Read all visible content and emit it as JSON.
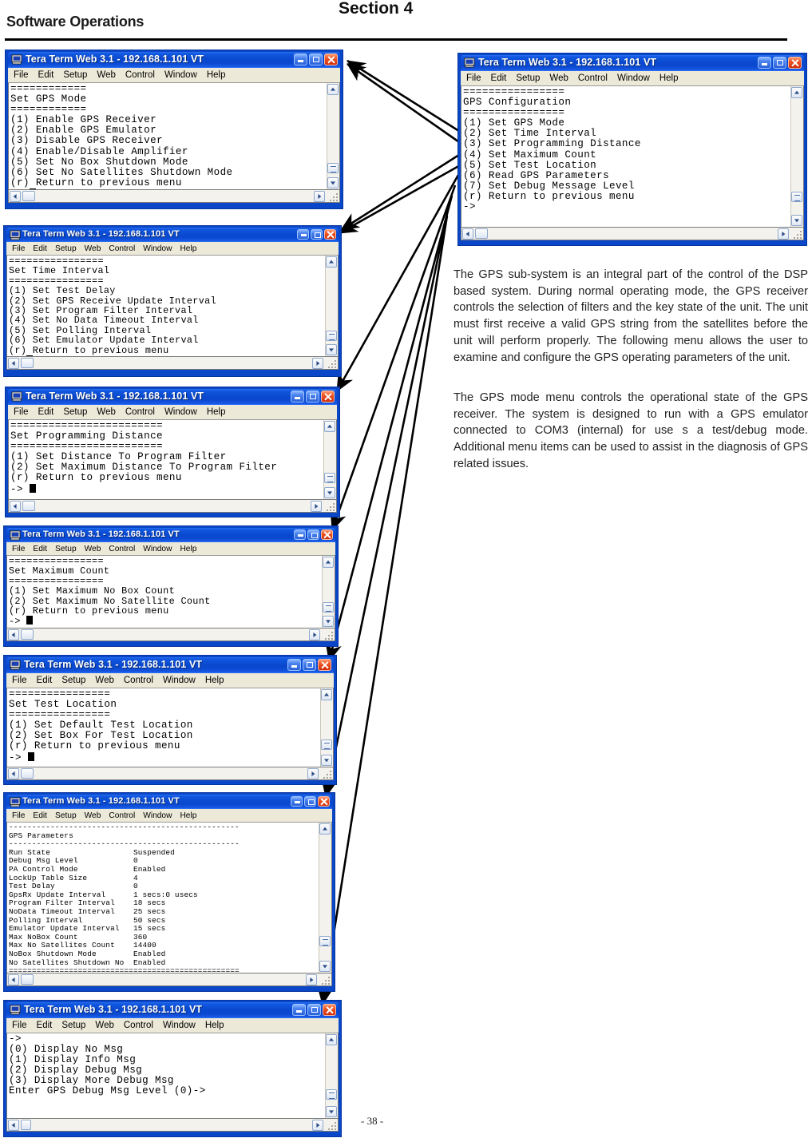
{
  "page": {
    "doc_title": "Software Operations",
    "section_label": "Section 4",
    "page_number": "- 38 -"
  },
  "body_text": {
    "paragraph_1": "The GPS sub-system is an integral part of the control of the DSP based system. During normal operating mode, the GPS receiver controls the selection of filters and the key state of the unit. The unit must first receive a valid GPS string from the satellites before the unit will perform properly. The following menu allows the user to examine and configure the GPS operating parameters of the unit.",
    "paragraph_2": "The GPS mode menu controls the operational state of the GPS receiver. The system is designed to run with a GPS emulator connected to COM3 (internal) for use s a test/debug mode. Additional menu items can be used to assist in the diagnosis of GPS related issues."
  },
  "window_common": {
    "title": "Tera Term Web 3.1 - 192.168.1.101 VT",
    "menus": [
      "File",
      "Edit",
      "Setup",
      "Web",
      "Control",
      "Window",
      "Help"
    ],
    "buttons": {
      "minimize": "Minimize",
      "maximize": "Maximize",
      "close": "Close"
    },
    "icons": {
      "app": "terminal-computer-icon",
      "minimize": "minimize-icon",
      "maximize": "maximize-icon",
      "close": "close-icon",
      "scroll_up": "scroll-up-arrow-icon",
      "scroll_down": "scroll-down-arrow-icon",
      "scroll_left": "scroll-left-arrow-icon",
      "scroll_right": "scroll-right-arrow-icon",
      "resize_grip": "resize-grip-icon"
    }
  },
  "windows": {
    "gps_mode": {
      "name": "Set GPS Mode",
      "terminal": "============\nSet GPS Mode\n============\n(1) Enable GPS Receiver\n(2) Enable GPS Emulator\n(3) Disable GPS Receiver\n(4) Enable/Disable Amplifier\n(5) Set No Box Shutdown Mode\n(6) Set No Satellites Shutdown Mode\n(r) Return to previous menu\n-> "
    },
    "time_interval": {
      "name": "Set Time Interval",
      "terminal": "================\nSet Time Interval\n================\n(1) Set Test Delay\n(2) Set GPS Receive Update Interval\n(3) Set Program Filter Interval\n(4) Set No Data Timeout Interval\n(5) Set Polling Interval\n(6) Set Emulator Update Interval\n(r) Return to previous menu\n-> "
    },
    "programming_distance": {
      "name": "Set Programming Distance",
      "terminal": "========================\nSet Programming Distance\n========================\n(1) Set Distance To Program Filter\n(2) Set Maximum Distance To Program Filter\n(r) Return to previous menu\n-> "
    },
    "maximum_count": {
      "name": "Set Maximum Count",
      "terminal": "================\nSet Maximum Count\n================\n(1) Set Maximum No Box Count\n(2) Set Maximum No Satellite Count\n(r) Return to previous menu\n-> "
    },
    "test_location": {
      "name": "Set Test Location",
      "terminal": "================\nSet Test Location\n================\n(1) Set Default Test Location\n(2) Set Box For Test Location\n(r) Return to previous menu\n-> "
    },
    "gps_parameters": {
      "name": "GPS Parameters",
      "terminal": "--------------------------------------------------\nGPS Parameters\n--------------------------------------------------\nRun State                  Suspended\nDebug Msg Level            0\nPA Control Mode            Enabled\nLockUp Table Size          4\nTest Delay                 0\nGpsRx Update Interval      1 secs:0 usecs\nProgram Filter Interval    18 secs\nNoData Timeout Interval    25 secs\nPolling Interval           50 secs\nEmulator Update Interval   15 secs\nMax NoBox Count            360\nMax No Satellites Count    14400\nNoBox Shutdown Mode        Enabled\nNo Satellites Shutdown No  Enabled\n==================================================",
      "rows": [
        {
          "label": "Run State",
          "value": "Suspended"
        },
        {
          "label": "Debug Msg Level",
          "value": "0"
        },
        {
          "label": "PA Control Mode",
          "value": "Enabled"
        },
        {
          "label": "LockUp Table Size",
          "value": "4"
        },
        {
          "label": "Test Delay",
          "value": "0"
        },
        {
          "label": "GpsRx Update Interval",
          "value": "1 secs:0 usecs"
        },
        {
          "label": "Program Filter Interval",
          "value": "18 secs"
        },
        {
          "label": "NoData Timeout Interval",
          "value": "25 secs"
        },
        {
          "label": "Polling Interval",
          "value": "50 secs"
        },
        {
          "label": "Emulator Update Interval",
          "value": "15 secs"
        },
        {
          "label": "Max NoBox Count",
          "value": "360"
        },
        {
          "label": "Max No Satellites Count",
          "value": "14400"
        },
        {
          "label": "NoBox Shutdown Mode",
          "value": "Enabled"
        },
        {
          "label": "No Satellites Shutdown No",
          "value": "Enabled"
        }
      ]
    },
    "debug_msg_level": {
      "name": "Set Debug Message Level",
      "terminal": "->\n(0) Display No Msg\n(1) Display Info Msg\n(2) Display Debug Msg\n(3) Display More Debug Msg\nEnter GPS Debug Msg Level (0)->"
    },
    "gps_configuration": {
      "name": "GPS Configuration",
      "terminal": "================\nGPS Configuration\n================\n(1) Set GPS Mode\n(2) Set Time Interval\n(3) Set Programming Distance\n(4) Set Maximum Count\n(5) Set Test Location\n(6) Read GPS Parameters\n(7) Set Debug Message Level\n(r) Return to previous menu\n->"
    }
  },
  "colors": {
    "titlebar_blue": "#0a49cf",
    "close_red": "#f05a28",
    "menubar": "#ece9d8",
    "terminal_bg": "#ffffff",
    "terminal_fg": "#000000"
  }
}
